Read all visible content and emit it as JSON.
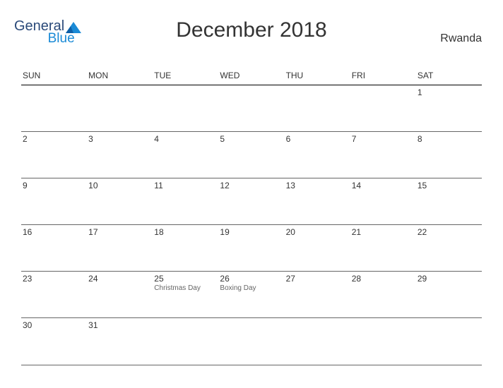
{
  "logo": {
    "line1": "General",
    "line2": "Blue"
  },
  "title": "December 2018",
  "country": "Rwanda",
  "day_headers": [
    "SUN",
    "MON",
    "TUE",
    "WED",
    "THU",
    "FRI",
    "SAT"
  ],
  "weeks": [
    [
      {
        "n": ""
      },
      {
        "n": ""
      },
      {
        "n": ""
      },
      {
        "n": ""
      },
      {
        "n": ""
      },
      {
        "n": ""
      },
      {
        "n": "1"
      }
    ],
    [
      {
        "n": "2"
      },
      {
        "n": "3"
      },
      {
        "n": "4"
      },
      {
        "n": "5"
      },
      {
        "n": "6"
      },
      {
        "n": "7"
      },
      {
        "n": "8"
      }
    ],
    [
      {
        "n": "9"
      },
      {
        "n": "10"
      },
      {
        "n": "11"
      },
      {
        "n": "12"
      },
      {
        "n": "13"
      },
      {
        "n": "14"
      },
      {
        "n": "15"
      }
    ],
    [
      {
        "n": "16"
      },
      {
        "n": "17"
      },
      {
        "n": "18"
      },
      {
        "n": "19"
      },
      {
        "n": "20"
      },
      {
        "n": "21"
      },
      {
        "n": "22"
      }
    ],
    [
      {
        "n": "23"
      },
      {
        "n": "24"
      },
      {
        "n": "25",
        "e": "Christmas Day"
      },
      {
        "n": "26",
        "e": "Boxing Day"
      },
      {
        "n": "27"
      },
      {
        "n": "28"
      },
      {
        "n": "29"
      }
    ],
    [
      {
        "n": "30"
      },
      {
        "n": "31"
      },
      {
        "n": ""
      },
      {
        "n": ""
      },
      {
        "n": ""
      },
      {
        "n": ""
      },
      {
        "n": ""
      }
    ]
  ]
}
